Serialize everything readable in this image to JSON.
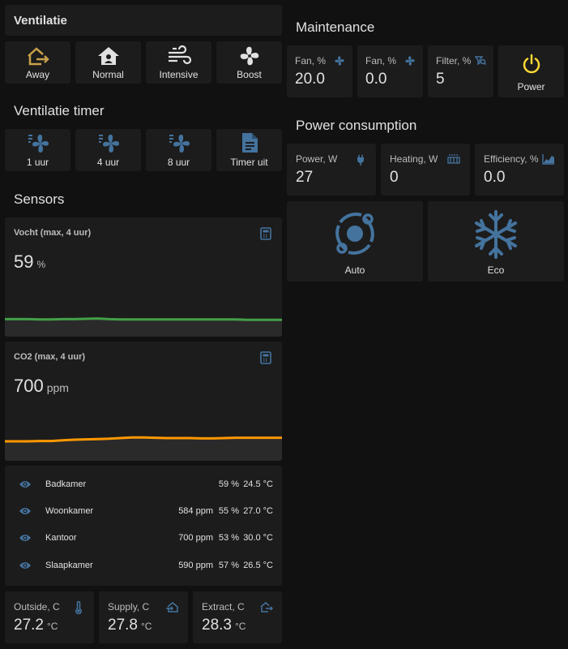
{
  "ventilatie": {
    "title": "Ventilatie",
    "buttons": [
      {
        "label": "Away",
        "icon": "home-export-icon"
      },
      {
        "label": "Normal",
        "icon": "home-icon"
      },
      {
        "label": "Intensive",
        "icon": "weather-windy-icon"
      },
      {
        "label": "Boost",
        "icon": "fan-icon"
      }
    ]
  },
  "timer": {
    "title": "Ventilatie timer",
    "buttons": [
      {
        "label": "1 uur",
        "icon": "fan-speed-1-icon"
      },
      {
        "label": "4 uur",
        "icon": "fan-speed-2-icon"
      },
      {
        "label": "8 uur",
        "icon": "fan-speed-3-icon"
      },
      {
        "label": "Timer uit",
        "icon": "file-document-icon"
      }
    ]
  },
  "sensors": {
    "title": "Sensors",
    "humidity": {
      "name": "Vocht (max, 4 uur)",
      "value": "59",
      "unit": "%",
      "color": "#43a047",
      "history": [
        0.46,
        0.46,
        0.46,
        0.47,
        0.47,
        0.46,
        0.46,
        0.45,
        0.44,
        0.46,
        0.47,
        0.47,
        0.47,
        0.47,
        0.47,
        0.47,
        0.47,
        0.47,
        0.47,
        0.47,
        0.47,
        0.48,
        0.48,
        0.48,
        0.48
      ]
    },
    "co2": {
      "name": "CO2 (max, 4 uur)",
      "value": "700",
      "unit": "ppm",
      "color": "#ff9800",
      "history": [
        0.4,
        0.4,
        0.4,
        0.39,
        0.39,
        0.37,
        0.35,
        0.34,
        0.33,
        0.32,
        0.3,
        0.28,
        0.28,
        0.29,
        0.3,
        0.3,
        0.3,
        0.31,
        0.31,
        0.3,
        0.29,
        0.29,
        0.29,
        0.29,
        0.29
      ]
    },
    "rooms": [
      {
        "name": "Badkamer",
        "co2": "",
        "humidity": "59 %",
        "temp": "24.5 °C"
      },
      {
        "name": "Woonkamer",
        "co2": "584 ppm",
        "humidity": "55 %",
        "temp": "27.0 °C"
      },
      {
        "name": "Kantoor",
        "co2": "700 ppm",
        "humidity": "53 %",
        "temp": "30.0 °C"
      },
      {
        "name": "Slaapkamer",
        "co2": "590 ppm",
        "humidity": "57 %",
        "temp": "26.5 °C"
      }
    ],
    "temps": [
      {
        "label": "Outside, C",
        "value": "27.2",
        "unit": "°C",
        "icon": "thermometer-icon"
      },
      {
        "label": "Supply, C",
        "value": "27.8",
        "unit": "°C",
        "icon": "home-import-icon"
      },
      {
        "label": "Extract, C",
        "value": "28.3",
        "unit": "°C",
        "icon": "home-export-icon"
      }
    ]
  },
  "maintenance": {
    "title": "Maintenance",
    "tiles": [
      {
        "label": "Fan, %",
        "value": "20.0",
        "icon": "fan-icon"
      },
      {
        "label": "Fan, %",
        "value": "0.0",
        "icon": "fan-icon"
      },
      {
        "label": "Filter, %",
        "value": "5",
        "icon": "filter-search-icon"
      }
    ],
    "power_button": {
      "label": "Power",
      "icon": "power-icon",
      "color": "#fdd835"
    }
  },
  "power": {
    "title": "Power consumption",
    "tiles": [
      {
        "label": "Power, W",
        "value": "27",
        "icon": "power-plug-icon"
      },
      {
        "label": "Heating, W",
        "value": "0",
        "icon": "radiator-icon"
      },
      {
        "label": "Efficiency, %",
        "value": "0.0",
        "icon": "chart-areaspline-icon"
      }
    ],
    "modes": [
      {
        "label": "Auto",
        "icon": "orbit-icon"
      },
      {
        "label": "Eco",
        "icon": "snowflake-icon"
      }
    ]
  },
  "colors": {
    "accent": "#44739e",
    "away": "#c8a04a",
    "background": "#111111",
    "card": "#1c1c1c"
  }
}
